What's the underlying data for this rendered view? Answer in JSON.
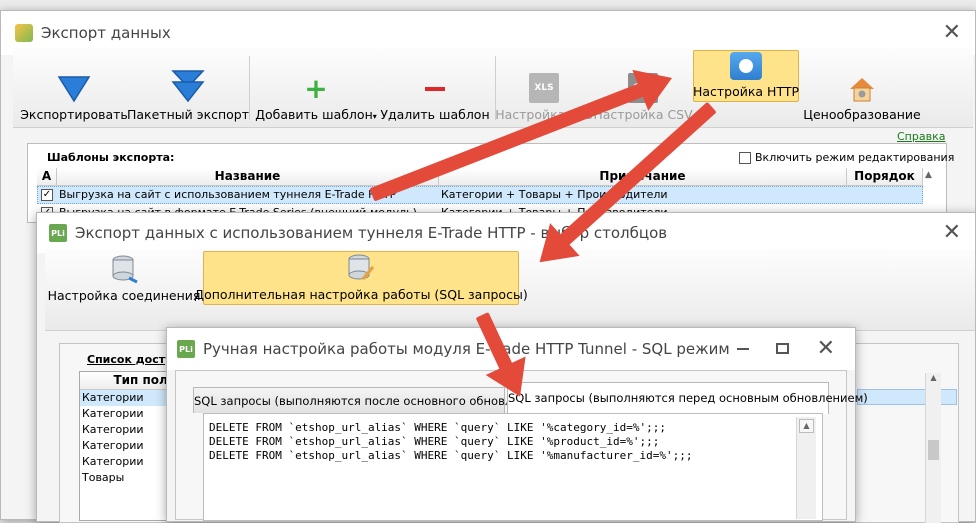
{
  "main": {
    "title": "Экспорт данных",
    "toolbar": {
      "export": "Экспортировать",
      "batch_export": "Пакетный экспорт",
      "add_template": "Добавить шаблон",
      "delete_template": "Удалить шаблон",
      "xls_settings": "Настройка XLS",
      "csv_settings": "Настройка CSV",
      "http_settings": "Настройка HTTP",
      "pricing": "Ценообразование",
      "xls_badge": "XLS",
      "csv_badge": "CSV"
    },
    "help_link": "Справка",
    "templates_label": "Шаблоны экспорта:",
    "edit_mode_label": "Включить режим редактирования",
    "columns": {
      "a": "A",
      "name": "Название",
      "note": "Примечание",
      "order": "Порядок"
    },
    "rows": [
      {
        "name": "Выгрузка на сайт с использованием туннеля E-Trade HTTP",
        "note": "Категории + Товары + Производители"
      },
      {
        "name": "Выгрузка на сайт в формате E-Trade Series (внешний модуль)",
        "note": "Категории + Товары + Производители"
      }
    ]
  },
  "second": {
    "title": "Экспорт данных с использованием туннеля E-Trade HTTP - выбор столбцов",
    "toolbar": {
      "connection": "Настройка соединения",
      "advanced": "Дополнительная настройка работы (SQL запросы)"
    },
    "list_label": "Список досту",
    "field_type_header": "Тип поля",
    "field_types": [
      "Категории",
      "Категории",
      "Категории",
      "Категории",
      "Категории",
      "Товары"
    ]
  },
  "third": {
    "title": "Ручная настройка работы модуля E-Trade HTTP Tunnel - SQL режим",
    "tabs": {
      "after": "SQL запросы (выполняются после основного обновления)",
      "before": "SQL запросы (выполняются перед основным обновлением)"
    },
    "sql_lines": [
      "DELETE FROM `etshop_url_alias` WHERE `query` LIKE '%category_id=%';;;",
      "DELETE FROM `etshop_url_alias` WHERE `query` LIKE '%product_id=%';;;",
      "DELETE FROM `etshop_url_alias` WHERE `query` LIKE '%manufacturer_id=%';;;"
    ]
  },
  "icons": {
    "app": "app-icon",
    "pli": "PLi"
  },
  "colors": {
    "highlight": "#ffe38a",
    "arrow": "#e34a3a",
    "selection": "#cfe8fb",
    "link": "#1a7a1a"
  }
}
